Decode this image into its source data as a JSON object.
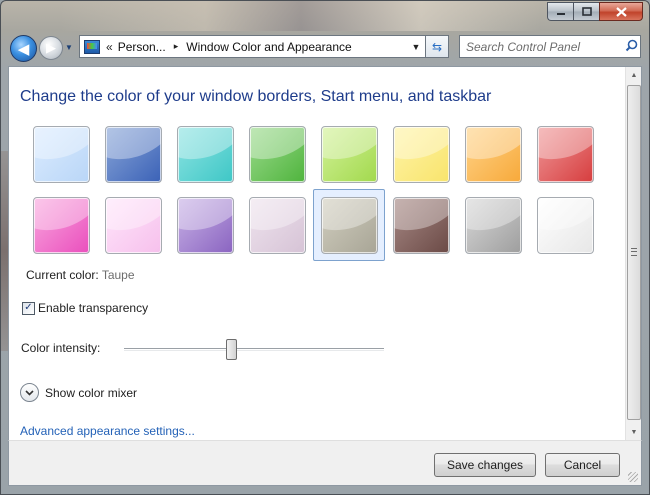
{
  "window": {
    "caption_buttons": {
      "minimize_icon": "minimize-icon",
      "maximize_icon": "maximize-icon",
      "close_icon": "close-icon"
    }
  },
  "nav": {
    "back_glyph": "◀",
    "forward_glyph": "▶",
    "recent_glyph": "▼"
  },
  "address": {
    "chevron": "«",
    "segments": [
      "Person...",
      "Window Color and Appearance"
    ],
    "separator_glyph": "▸",
    "dropdown_glyph": "▼"
  },
  "refresh_glyph": "⇆",
  "search": {
    "placeholder": "Search Control Panel",
    "icon_glyph": "⚲"
  },
  "main": {
    "title": "Change the color of your window borders, Start menu, and taskbar",
    "swatches": [
      {
        "row": 0,
        "col": 0,
        "color": "#dcecff",
        "color2": "#b9d6f7"
      },
      {
        "row": 0,
        "col": 1,
        "color": "#8aa6d8",
        "color2": "#3b62b7"
      },
      {
        "row": 0,
        "col": 2,
        "color": "#8fe4e3",
        "color2": "#3ec7c6"
      },
      {
        "row": 0,
        "col": 3,
        "color": "#9ddb8e",
        "color2": "#4fb43d"
      },
      {
        "row": 0,
        "col": 4,
        "color": "#d3f29a",
        "color2": "#a2d94d"
      },
      {
        "row": 0,
        "col": 5,
        "color": "#fff4a8",
        "color2": "#f8e46c"
      },
      {
        "row": 0,
        "col": 6,
        "color": "#ffd48a",
        "color2": "#f7a93a"
      },
      {
        "row": 0,
        "col": 7,
        "color": "#f0999a",
        "color2": "#d63d3e"
      },
      {
        "row": 1,
        "col": 0,
        "color": "#f9a8df",
        "color2": "#ea4fbd"
      },
      {
        "row": 1,
        "col": 1,
        "color": "#ffe6fb",
        "color2": "#f6c0ec"
      },
      {
        "row": 1,
        "col": 2,
        "color": "#c9b3e6",
        "color2": "#8a64c1"
      },
      {
        "row": 1,
        "col": 3,
        "color": "#efe4ee",
        "color2": "#d6c3d6"
      },
      {
        "row": 1,
        "col": 4,
        "color": "#d2cfc0",
        "color2": "#a8a596"
      },
      {
        "row": 1,
        "col": 5,
        "color": "#a88a86",
        "color2": "#6b4a46"
      },
      {
        "row": 1,
        "col": 6,
        "color": "#d9d9d9",
        "color2": "#9e9e9e"
      },
      {
        "row": 1,
        "col": 7,
        "color": "#ffffff",
        "color2": "#e7e7e7"
      }
    ],
    "selected_index": 12,
    "current_color_label": "Current color:",
    "current_color_value": "Taupe",
    "enable_transparency_label": "Enable transparency",
    "enable_transparency_checked": true,
    "check_glyph": "✓",
    "color_intensity_label": "Color intensity:",
    "color_intensity_value": 0.41,
    "show_color_mixer_label": "Show color mixer",
    "mixer_glyph": "⌄",
    "advanced_link": "Advanced appearance settings..."
  },
  "scrollbar": {
    "up_glyph": "▲",
    "down_glyph": "▼"
  },
  "footer": {
    "save_label": "Save changes",
    "cancel_label": "Cancel"
  }
}
